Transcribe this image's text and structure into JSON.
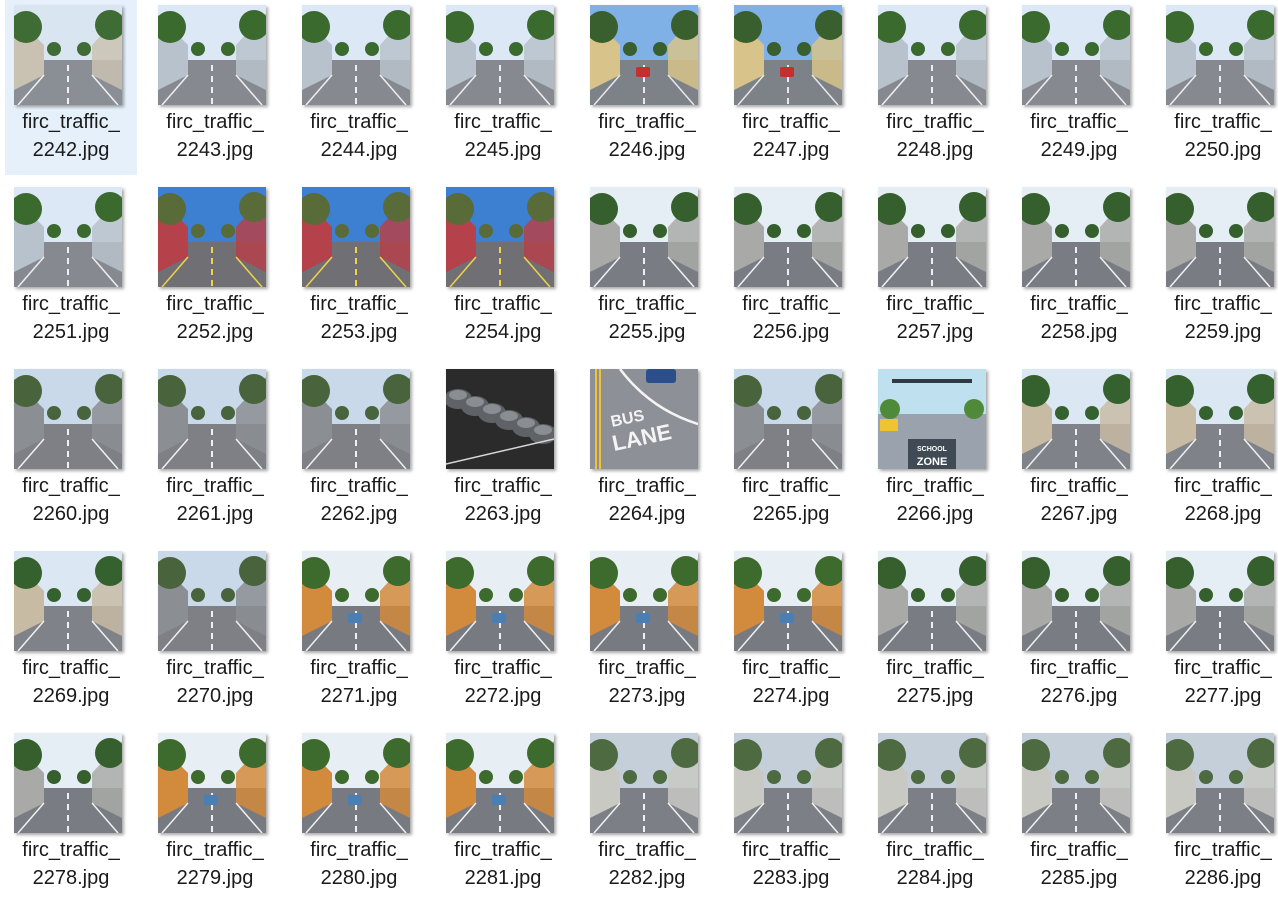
{
  "files": [
    {
      "line1": "firc_traffic_",
      "line2": "2242.jpg",
      "scene": "street-houses",
      "selected": true
    },
    {
      "line1": "firc_traffic_",
      "line2": "2243.jpg",
      "scene": "street-walls"
    },
    {
      "line1": "firc_traffic_",
      "line2": "2244.jpg",
      "scene": "street-walls"
    },
    {
      "line1": "firc_traffic_",
      "line2": "2245.jpg",
      "scene": "street-walls"
    },
    {
      "line1": "firc_traffic_",
      "line2": "2246.jpg",
      "scene": "street-cars"
    },
    {
      "line1": "firc_traffic_",
      "line2": "2247.jpg",
      "scene": "street-cars"
    },
    {
      "line1": "firc_traffic_",
      "line2": "2248.jpg",
      "scene": "street-walls"
    },
    {
      "line1": "firc_traffic_",
      "line2": "2249.jpg",
      "scene": "street-walls"
    },
    {
      "line1": "firc_traffic_",
      "line2": "2250.jpg",
      "scene": "street-walls"
    },
    {
      "line1": "firc_traffic_",
      "line2": "2251.jpg",
      "scene": "street-walls"
    },
    {
      "line1": "firc_traffic_",
      "line2": "2252.jpg",
      "scene": "city-shops"
    },
    {
      "line1": "firc_traffic_",
      "line2": "2253.jpg",
      "scene": "city-shops"
    },
    {
      "line1": "firc_traffic_",
      "line2": "2254.jpg",
      "scene": "city-shops"
    },
    {
      "line1": "firc_traffic_",
      "line2": "2255.jpg",
      "scene": "avenue-trees"
    },
    {
      "line1": "firc_traffic_",
      "line2": "2256.jpg",
      "scene": "avenue-trees"
    },
    {
      "line1": "firc_traffic_",
      "line2": "2257.jpg",
      "scene": "avenue-trees"
    },
    {
      "line1": "firc_traffic_",
      "line2": "2258.jpg",
      "scene": "avenue-trees"
    },
    {
      "line1": "firc_traffic_",
      "line2": "2259.jpg",
      "scene": "avenue-trees"
    },
    {
      "line1": "firc_traffic_",
      "line2": "2260.jpg",
      "scene": "city-tall"
    },
    {
      "line1": "firc_traffic_",
      "line2": "2261.jpg",
      "scene": "city-tall"
    },
    {
      "line1": "firc_traffic_",
      "line2": "2262.jpg",
      "scene": "city-tall"
    },
    {
      "line1": "firc_traffic_",
      "line2": "2263.jpg",
      "scene": "parked-cars"
    },
    {
      "line1": "firc_traffic_",
      "line2": "2264.jpg",
      "scene": "bus-lane",
      "text_a": "BUS",
      "text_b": "LANE"
    },
    {
      "line1": "firc_traffic_",
      "line2": "2265.jpg",
      "scene": "city-tall"
    },
    {
      "line1": "firc_traffic_",
      "line2": "2266.jpg",
      "scene": "school-zone",
      "text_a": "SCHOOL",
      "text_b": "ZONE"
    },
    {
      "line1": "firc_traffic_",
      "line2": "2267.jpg",
      "scene": "avenue-palms"
    },
    {
      "line1": "firc_traffic_",
      "line2": "2268.jpg",
      "scene": "avenue-palms"
    },
    {
      "line1": "firc_traffic_",
      "line2": "2269.jpg",
      "scene": "avenue-palms"
    },
    {
      "line1": "firc_traffic_",
      "line2": "2270.jpg",
      "scene": "city-tall"
    },
    {
      "line1": "firc_traffic_",
      "line2": "2271.jpg",
      "scene": "tuktuk-road"
    },
    {
      "line1": "firc_traffic_",
      "line2": "2272.jpg",
      "scene": "tuktuk-road"
    },
    {
      "line1": "firc_traffic_",
      "line2": "2273.jpg",
      "scene": "tuktuk-road"
    },
    {
      "line1": "firc_traffic_",
      "line2": "2274.jpg",
      "scene": "tuktuk-road"
    },
    {
      "line1": "firc_traffic_",
      "line2": "2275.jpg",
      "scene": "avenue-trees"
    },
    {
      "line1": "firc_traffic_",
      "line2": "2276.jpg",
      "scene": "avenue-trees"
    },
    {
      "line1": "firc_traffic_",
      "line2": "2277.jpg",
      "scene": "avenue-trees"
    },
    {
      "line1": "firc_traffic_",
      "line2": "2278.jpg",
      "scene": "avenue-trees"
    },
    {
      "line1": "firc_traffic_",
      "line2": "2279.jpg",
      "scene": "tuktuk-road"
    },
    {
      "line1": "firc_traffic_",
      "line2": "2280.jpg",
      "scene": "tuktuk-road"
    },
    {
      "line1": "firc_traffic_",
      "line2": "2281.jpg",
      "scene": "tuktuk-road"
    },
    {
      "line1": "firc_traffic_",
      "line2": "2282.jpg",
      "scene": "junction-cloudy"
    },
    {
      "line1": "firc_traffic_",
      "line2": "2283.jpg",
      "scene": "junction-cloudy"
    },
    {
      "line1": "firc_traffic_",
      "line2": "2284.jpg",
      "scene": "junction-cloudy"
    },
    {
      "line1": "firc_traffic_",
      "line2": "2285.jpg",
      "scene": "junction-cloudy"
    },
    {
      "line1": "firc_traffic_",
      "line2": "2286.jpg",
      "scene": "junction-cloudy"
    }
  ]
}
